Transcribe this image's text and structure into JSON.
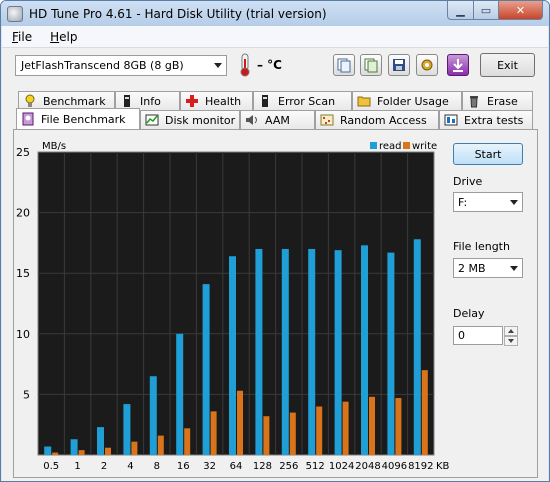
{
  "window": {
    "title": "HD Tune Pro 4.61 - Hard Disk Utility (trial version)"
  },
  "menu": {
    "file_prefix": "",
    "file_ul": "F",
    "file_rest": "ile",
    "help_ul": "H",
    "help_rest": "elp"
  },
  "toolbar": {
    "drive": "JetFlashTranscend 8GB    (8 gB)",
    "temperature": "– °C",
    "exit_label": "Exit",
    "icons": [
      "copy-info-icon",
      "copy-screen-icon",
      "save-icon",
      "options-icon",
      "download-icon"
    ]
  },
  "tabs_top": [
    {
      "label": "Benchmark",
      "icon": "benchmark-icon"
    },
    {
      "label": "Info",
      "icon": "info-icon"
    },
    {
      "label": "Health",
      "icon": "health-icon"
    },
    {
      "label": "Error Scan",
      "icon": "error-scan-icon"
    },
    {
      "label": "Folder Usage",
      "icon": "folder-icon"
    },
    {
      "label": "Erase",
      "icon": "trash-icon"
    }
  ],
  "tabs_bottom": [
    {
      "label": "File Benchmark",
      "icon": "file-benchmark-icon",
      "active": true
    },
    {
      "label": "Disk monitor",
      "icon": "disk-monitor-icon"
    },
    {
      "label": "AAM",
      "icon": "speaker-icon"
    },
    {
      "label": "Random Access",
      "icon": "random-access-icon"
    },
    {
      "label": "Extra tests",
      "icon": "extra-tests-icon"
    }
  ],
  "side": {
    "start_label": "Start",
    "drive_label": "Drive",
    "drive_value": "F:",
    "file_length_label": "File length",
    "file_length_value": "2 MB",
    "delay_label": "Delay",
    "delay_value": "0"
  },
  "colors": {
    "read": "#1f9fd6",
    "write": "#d9741a",
    "plot_bg": "#1b1b1b",
    "grid": "#3a3a3a"
  },
  "chart_data": {
    "type": "bar",
    "ylabel": "MB/s",
    "xunit": "KB",
    "ylim": [
      0,
      25
    ],
    "yticks": [
      5,
      10,
      15,
      20,
      25
    ],
    "grid": true,
    "legend_position": "top-right",
    "categories": [
      "0.5",
      "1",
      "2",
      "4",
      "8",
      "16",
      "32",
      "64",
      "128",
      "256",
      "512",
      "1024",
      "2048",
      "4096",
      "8192"
    ],
    "series": [
      {
        "name": "read",
        "values": [
          0.7,
          1.3,
          2.3,
          4.2,
          6.5,
          10.0,
          14.1,
          16.4,
          17.0,
          17.0,
          17.0,
          16.9,
          17.3,
          16.7,
          17.8
        ]
      },
      {
        "name": "write",
        "values": [
          0.2,
          0.4,
          0.6,
          1.1,
          1.6,
          2.2,
          3.6,
          5.3,
          3.2,
          3.5,
          4.0,
          4.4,
          4.8,
          4.7,
          7.0
        ]
      }
    ]
  }
}
